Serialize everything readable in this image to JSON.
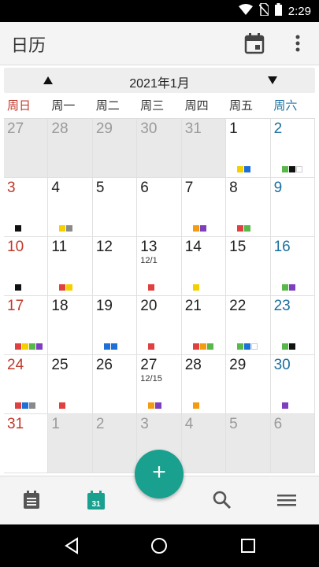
{
  "status": {
    "time": "2:29"
  },
  "appbar": {
    "title": "日历"
  },
  "calendar": {
    "month_label": "2021年1月",
    "weekdays": [
      "周日",
      "周一",
      "周二",
      "周三",
      "周四",
      "周五",
      "周六"
    ],
    "weeks": [
      [
        {
          "d": "27",
          "other": true
        },
        {
          "d": "28",
          "other": true
        },
        {
          "d": "29",
          "other": true
        },
        {
          "d": "30",
          "other": true
        },
        {
          "d": "31",
          "other": true
        },
        {
          "d": "1",
          "marks": [
            "#f5d000",
            "#1e6fd6"
          ]
        },
        {
          "d": "2",
          "marks": [
            "#58b84a",
            "#111111",
            "white"
          ]
        }
      ],
      [
        {
          "d": "3",
          "marks": [
            "#111111"
          ]
        },
        {
          "d": "4",
          "marks": [
            "#f5d000",
            "#8a8a8a"
          ]
        },
        {
          "d": "5"
        },
        {
          "d": "6"
        },
        {
          "d": "7",
          "marks": [
            "#f39c12",
            "#7e3fbf"
          ]
        },
        {
          "d": "8",
          "marks": [
            "#e04040",
            "#58b84a"
          ]
        },
        {
          "d": "9"
        }
      ],
      [
        {
          "d": "10",
          "marks": [
            "#111111"
          ]
        },
        {
          "d": "11",
          "marks": [
            "#e04040",
            "#f5d000"
          ]
        },
        {
          "d": "12"
        },
        {
          "d": "13",
          "sub": "12/1",
          "marks": [
            "#e04040"
          ]
        },
        {
          "d": "14",
          "marks": [
            "#f5d000"
          ]
        },
        {
          "d": "15"
        },
        {
          "d": "16",
          "marks": [
            "#58b84a",
            "#7e3fbf"
          ]
        }
      ],
      [
        {
          "d": "17",
          "marks": [
            "#e04040",
            "#f5d000",
            "#58b84a",
            "#7e3fbf"
          ]
        },
        {
          "d": "18"
        },
        {
          "d": "19",
          "marks": [
            "#1e6fd6",
            "#1e6fd6"
          ]
        },
        {
          "d": "20",
          "marks": [
            "#e04040"
          ]
        },
        {
          "d": "21",
          "marks": [
            "#e04040",
            "#f39c12",
            "#58b84a"
          ]
        },
        {
          "d": "22",
          "marks": [
            "#58b84a",
            "#1e6fd6",
            "white"
          ]
        },
        {
          "d": "23",
          "marks": [
            "#58b84a",
            "#111111"
          ]
        }
      ],
      [
        {
          "d": "24",
          "marks": [
            "#e04040",
            "#1e6fd6",
            "#8a8a8a"
          ]
        },
        {
          "d": "25",
          "marks": [
            "#e04040"
          ]
        },
        {
          "d": "26"
        },
        {
          "d": "27",
          "sub": "12/15",
          "marks": [
            "#f39c12",
            "#7e3fbf"
          ]
        },
        {
          "d": "28",
          "marks": [
            "#f39c12"
          ]
        },
        {
          "d": "29"
        },
        {
          "d": "30",
          "marks": [
            "#7e3fbf"
          ]
        }
      ],
      [
        {
          "d": "31"
        },
        {
          "d": "1",
          "other": true
        },
        {
          "d": "2",
          "other": true
        },
        {
          "d": "3",
          "other": true
        },
        {
          "d": "4",
          "other": true
        },
        {
          "d": "5",
          "other": true
        },
        {
          "d": "6",
          "other": true
        }
      ]
    ]
  },
  "fab": {
    "label": "+"
  },
  "bottom_nav": {
    "today_badge": "31"
  },
  "colors": {
    "accent": "#19a08e",
    "sunday": "#c0392b",
    "saturday": "#1a6fa0"
  }
}
